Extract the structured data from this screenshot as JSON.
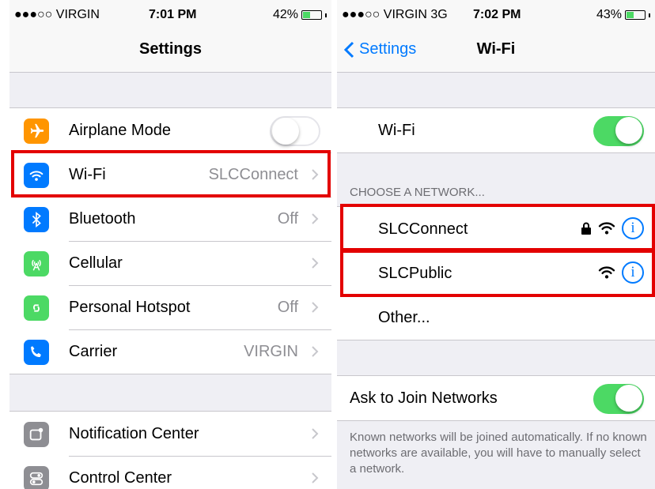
{
  "left_screen": {
    "status_bar": {
      "carrier": "●●●○○ VIRGIN",
      "time": "7:01 PM",
      "battery": "42%",
      "battery_level": 0.42
    },
    "nav_title": "Settings",
    "group1": [
      {
        "label": "Airplane Mode",
        "icon": "airplane-icon",
        "color": "#ff9500",
        "toggle": "off"
      },
      {
        "label": "Wi-Fi",
        "value": "SLCConnect",
        "icon": "wifi-icon",
        "color": "#007aff"
      },
      {
        "label": "Bluetooth",
        "value": "Off",
        "icon": "bluetooth-icon",
        "color": "#007aff"
      },
      {
        "label": "Cellular",
        "value": "",
        "icon": "cellular-antenna-icon",
        "color": "#4cd964"
      },
      {
        "label": "Personal Hotspot",
        "value": "Off",
        "icon": "hotspot-icon",
        "color": "#4cd964"
      },
      {
        "label": "Carrier",
        "value": "VIRGIN",
        "icon": "phone-icon",
        "color": "#007aff"
      }
    ],
    "group2": [
      {
        "label": "Notification Center",
        "icon": "notification-center-icon",
        "color": "#8e8e93"
      },
      {
        "label": "Control Center",
        "icon": "control-center-icon",
        "color": "#8e8e93"
      }
    ]
  },
  "right_screen": {
    "status_bar": {
      "carrier": "●●●○○ VIRGIN  3G",
      "time": "7:02 PM",
      "battery": "43%",
      "battery_level": 0.43
    },
    "back_label": "Settings",
    "nav_title": "Wi-Fi",
    "wifi_row": {
      "label": "Wi-Fi",
      "toggle": "on"
    },
    "section_header": "CHOOSE A NETWORK...",
    "networks": [
      {
        "name": "SLCConnect",
        "locked": true
      },
      {
        "name": "SLCPublic",
        "locked": false
      },
      {
        "name": "Other..."
      }
    ],
    "ask_row": {
      "label": "Ask to Join Networks",
      "toggle": "on"
    },
    "footer": "Known networks will be joined automatically. If no known networks are available, you will have to manually select a network."
  },
  "colors": {
    "accent": "#007aff",
    "highlight": "#e30000",
    "toggle_on": "#4cd964"
  }
}
